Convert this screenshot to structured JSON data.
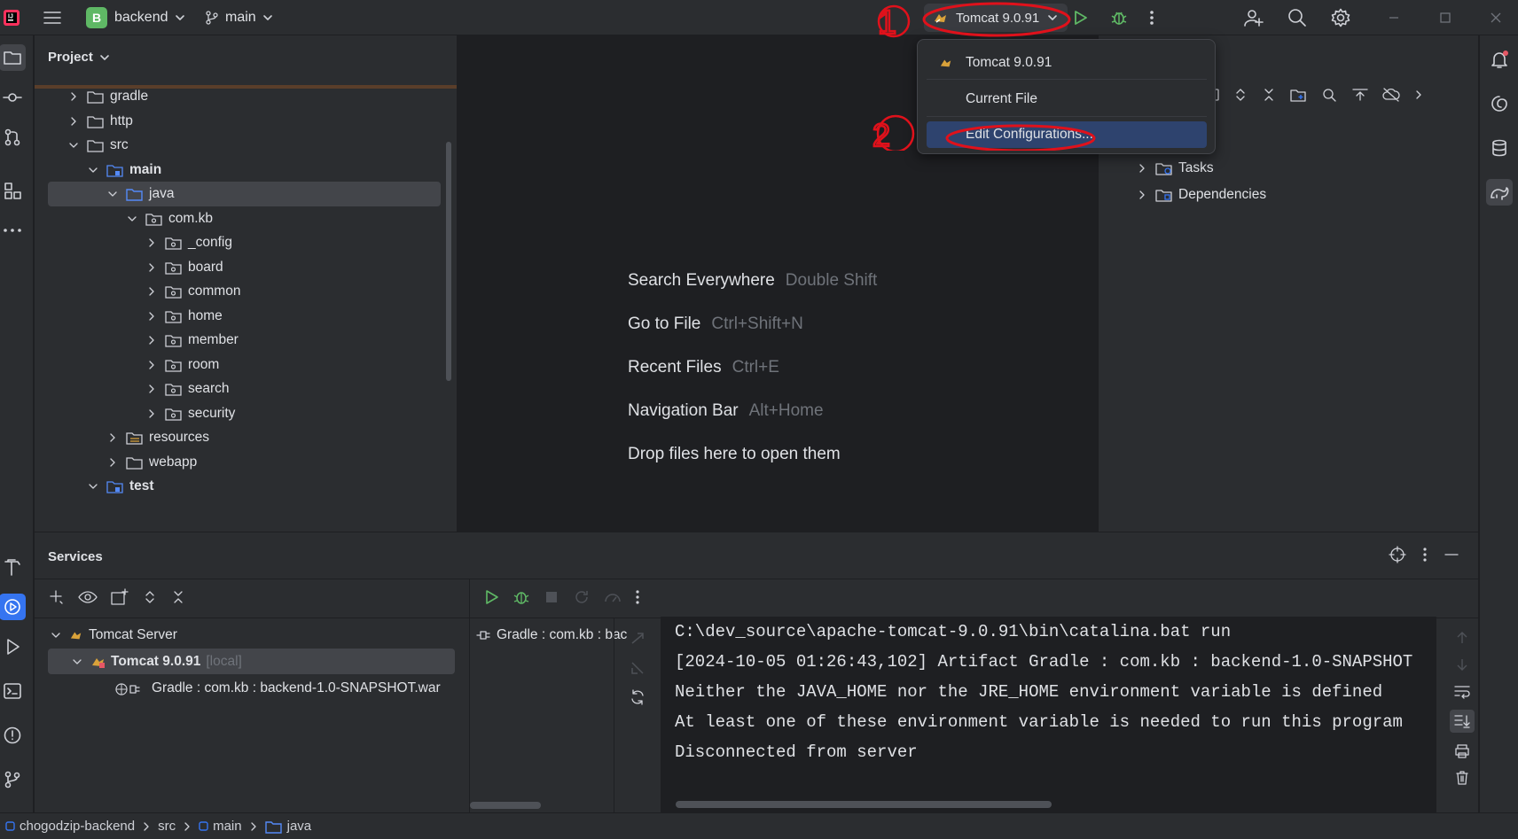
{
  "titlebar": {
    "project_badge": "B",
    "project_name": "backend",
    "branch": "main",
    "run_config": "Tomcat 9.0.91"
  },
  "project_panel": {
    "title": "Project",
    "tree": [
      {
        "label": "gradle",
        "bold": false
      },
      {
        "label": "http",
        "bold": false
      },
      {
        "label": "src",
        "bold": false
      },
      {
        "label": "main",
        "bold": true
      },
      {
        "label": "java",
        "bold": false
      },
      {
        "label": "com.kb",
        "bold": false
      },
      {
        "label": "_config",
        "bold": false
      },
      {
        "label": "board",
        "bold": false
      },
      {
        "label": "common",
        "bold": false
      },
      {
        "label": "home",
        "bold": false
      },
      {
        "label": "member",
        "bold": false
      },
      {
        "label": "room",
        "bold": false
      },
      {
        "label": "search",
        "bold": false
      },
      {
        "label": "security",
        "bold": false
      },
      {
        "label": "resources",
        "bold": false
      },
      {
        "label": "webapp",
        "bold": false
      },
      {
        "label": "test",
        "bold": true
      }
    ]
  },
  "editor_hints": [
    {
      "action": "Search Everywhere",
      "shortcut": "Double Shift"
    },
    {
      "action": "Go to File",
      "shortcut": "Ctrl+Shift+N"
    },
    {
      "action": "Recent Files",
      "shortcut": "Ctrl+E"
    },
    {
      "action": "Navigation Bar",
      "shortcut": "Alt+Home"
    },
    {
      "action": "Drop files here to open them",
      "shortcut": ""
    }
  ],
  "gradle_panel": {
    "items": [
      "Tasks",
      "Dependencies"
    ]
  },
  "run_popup": {
    "items": [
      "Tomcat 9.0.91",
      "Current File",
      "Edit Configurations..."
    ],
    "selected_index": 2
  },
  "annotations": {
    "mark1": "1",
    "mark2": "2"
  },
  "services": {
    "title": "Services",
    "tree": [
      {
        "label": "Tomcat Server",
        "suffix": ""
      },
      {
        "label": "Tomcat 9.0.91",
        "suffix": "[local]"
      },
      {
        "label": "Gradle : com.kb : backend-1.0-SNAPSHOT.war",
        "suffix": ""
      }
    ],
    "deployment_item": "Gradle : com.kb : bac",
    "console": [
      "C:\\dev_source\\apache-tomcat-9.0.91\\bin\\catalina.bat run",
      "[2024-10-05 01:26:43,102] Artifact Gradle : com.kb : backend-1.0-SNAPSHOT",
      "Neither the JAVA_HOME nor the JRE_HOME environment variable is defined",
      "At least one of these environment variable is needed to run this program",
      "Disconnected from server"
    ]
  },
  "statusbar": {
    "crumbs": [
      "chogodzip-backend",
      "src",
      "main",
      "java"
    ]
  },
  "colors": {
    "accent_blue": "#3574f0",
    "selection": "#2e436e",
    "run_green": "#5fb865",
    "annotation_red": "#e0111b"
  }
}
